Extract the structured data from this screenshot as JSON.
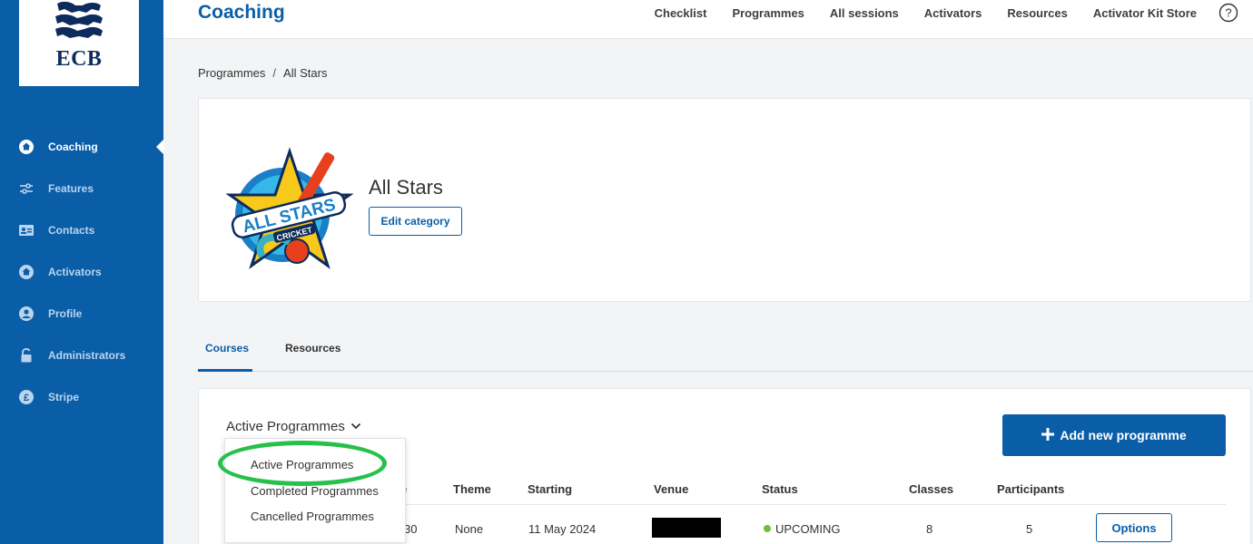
{
  "brand": {
    "logo_text": "ECB"
  },
  "sidebar": {
    "items": [
      {
        "label": "Coaching",
        "icon": "home-icon"
      },
      {
        "label": "Features",
        "icon": "sliders-icon"
      },
      {
        "label": "Contacts",
        "icon": "id-card-icon"
      },
      {
        "label": "Activators",
        "icon": "home-icon"
      },
      {
        "label": "Profile",
        "icon": "user-icon"
      },
      {
        "label": "Administrators",
        "icon": "lock-icon"
      },
      {
        "label": "Stripe",
        "icon": "pound-icon"
      }
    ],
    "active_item": "Coaching"
  },
  "header": {
    "title": "Coaching",
    "links": [
      "Checklist",
      "Programmes",
      "All sessions",
      "Activators",
      "Resources",
      "Activator Kit Store"
    ],
    "help_icon": "question-circle-icon"
  },
  "breadcrumb": {
    "items": [
      "Programmes",
      "All Stars"
    ],
    "separator": "/"
  },
  "category": {
    "title": "All Stars",
    "edit_label": "Edit category",
    "logo": {
      "line1": "ALL STARS",
      "line2": "CRICKET"
    }
  },
  "tabs": [
    {
      "label": "Courses",
      "active": true
    },
    {
      "label": "Resources",
      "active": false
    }
  ],
  "programmes": {
    "filter": {
      "selected": "Active Programmes",
      "options": [
        "Active Programmes",
        "Completed Programmes",
        "Cancelled Programmes"
      ]
    },
    "add_label": "Add new programme",
    "columns": [
      "Theme",
      "Starting",
      "Venue",
      "Status",
      "Classes",
      "Participants"
    ],
    "partial_column_tail": "e",
    "rows": [
      {
        "first_col_tail": "30",
        "theme": "None",
        "starting": "11 May 2024",
        "venue": "",
        "status": "UPCOMING",
        "classes": "8",
        "participants": "5",
        "options_label": "Options"
      }
    ]
  },
  "colors": {
    "primary": "#0a5ea8",
    "sidebar": "#0a5ea8",
    "status_upcoming": "#6fbf3a",
    "highlight": "#26c04a"
  }
}
